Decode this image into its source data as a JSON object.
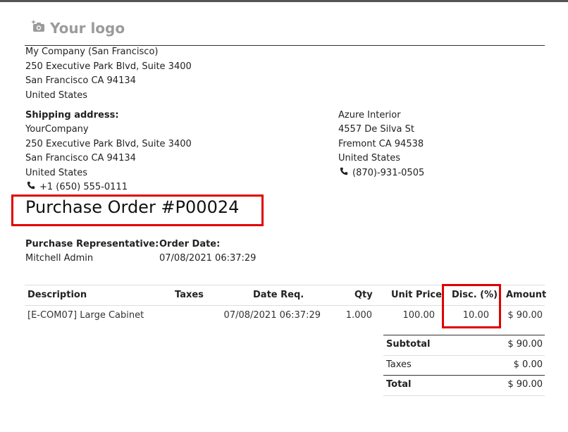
{
  "logo": {
    "text": "Your logo",
    "icon": "camera-plus-icon"
  },
  "company": {
    "name": "My Company (San Francisco)",
    "street": "250 Executive Park Blvd, Suite 3400",
    "city": "San Francisco CA 94134",
    "country": "United States"
  },
  "shipping": {
    "label": "Shipping address:",
    "name": "YourCompany",
    "street": "250 Executive Park Blvd, Suite 3400",
    "city": "San Francisco CA 94134",
    "country": "United States",
    "phone": "+1 (650) 555-0111"
  },
  "vendor": {
    "name": "Azure Interior",
    "street": "4557 De Silva St",
    "city": "Fremont CA 94538",
    "country": "United States",
    "phone": "(870)-931-0505"
  },
  "title": "Purchase Order #P00024",
  "info": {
    "rep_label": "Purchase Representative:",
    "rep_value": "Mitchell Admin",
    "date_label": "Order Date:",
    "date_value": "07/08/2021 06:37:29"
  },
  "table": {
    "headers": {
      "description": "Description",
      "taxes": "Taxes",
      "date_req": "Date Req.",
      "qty": "Qty",
      "unit_price": "Unit Price",
      "disc": "Disc. (%)",
      "amount": "Amount"
    },
    "rows": [
      {
        "description": "[E-COM07] Large Cabinet",
        "taxes": "",
        "date_req": "07/08/2021 06:37:29",
        "qty": "1.000",
        "unit_price": "100.00",
        "disc": "10.00",
        "amount": "$ 90.00"
      }
    ]
  },
  "totals": {
    "subtotal_label": "Subtotal",
    "subtotal_value": "$ 90.00",
    "taxes_label": "Taxes",
    "taxes_value": "$ 0.00",
    "total_label": "Total",
    "total_value": "$ 90.00"
  },
  "colors": {
    "highlight": "#e00000",
    "logo": "#9b9b9b"
  }
}
